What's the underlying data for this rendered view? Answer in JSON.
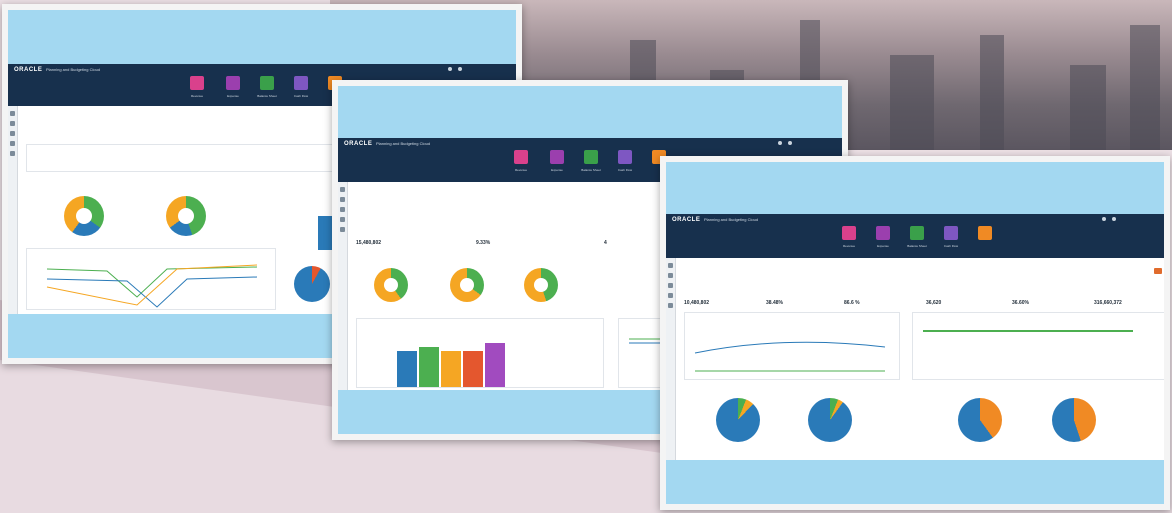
{
  "app": {
    "brand": "ORACLE",
    "product": "Planning and Budgeting Cloud"
  },
  "screens": [
    {
      "cards": [
        "Revenue",
        "Expense",
        "Balance Sheet",
        "Cash Flow",
        "Reports"
      ]
    },
    {
      "cards": [
        "Revenue",
        "Expense",
        "Balance Sheet",
        "Cash Flow",
        "Reports"
      ],
      "kpi_values": [
        "15,480,802",
        "9.33%",
        "4"
      ]
    },
    {
      "cards": [
        "Revenue",
        "Expense",
        "Balance Sheet",
        "Cash Flow",
        "Reports"
      ],
      "kpi_values": [
        "10,480,802",
        "38.48%",
        "86.6 %",
        "36,620",
        "36.60%",
        "316,660,372"
      ]
    }
  ],
  "colors": {
    "band": "#a3d8f1",
    "header": "#17304d",
    "tile_pink": "#d9418c",
    "tile_purple": "#9b3fae",
    "tile_green": "#3aa04a",
    "tile_violet": "#7e57c2",
    "tile_orange": "#f08a24",
    "series_blue": "#2a7ab8",
    "series_green": "#4caf50",
    "series_orange": "#f5a623",
    "series_red": "#e4572e",
    "series_purple": "#a14bbf"
  }
}
